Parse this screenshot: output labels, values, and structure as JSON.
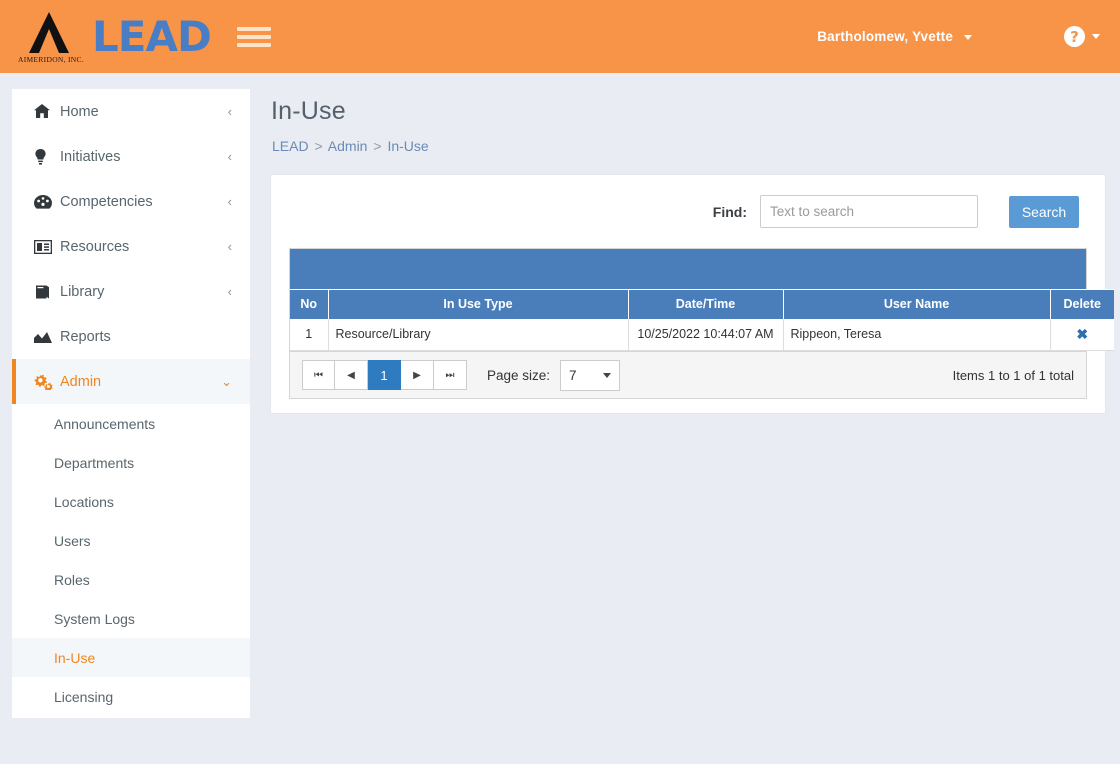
{
  "header": {
    "brand_text": "LEAD",
    "brand_corp": "AIMERIDON, INC.",
    "menu_icon": "hamburger-icon",
    "user_name": "Bartholomew, Yvette",
    "help_glyph": "?",
    "accent_color": "#f79448",
    "logo_color": "#4a7ec4"
  },
  "sidebar": {
    "items": [
      {
        "label": "Home",
        "icon": "home-icon",
        "glyph": "⌂",
        "chevron": "‹",
        "active": false
      },
      {
        "label": "Initiatives",
        "icon": "lightbulb-icon",
        "glyph": "Ὂ1",
        "chevron": "‹",
        "active": false
      },
      {
        "label": "Competencies",
        "icon": "gauge-icon",
        "glyph": "◔",
        "chevron": "‹",
        "active": false
      },
      {
        "label": "Resources",
        "icon": "id-card-icon",
        "glyph": "▤",
        "chevron": "‹",
        "active": false
      },
      {
        "label": "Library",
        "icon": "book-icon",
        "glyph": "◧",
        "chevron": "‹",
        "active": false
      },
      {
        "label": "Reports",
        "icon": "chart-area-icon",
        "glyph": "▲",
        "chevron": "",
        "active": false
      },
      {
        "label": "Admin",
        "icon": "gears-icon",
        "glyph": "⚙",
        "chevron": "⌄",
        "active": true
      }
    ],
    "sub_items": [
      {
        "label": "Announcements",
        "active": false
      },
      {
        "label": "Departments",
        "active": false
      },
      {
        "label": "Locations",
        "active": false
      },
      {
        "label": "Users",
        "active": false
      },
      {
        "label": "Roles",
        "active": false
      },
      {
        "label": "System Logs",
        "active": false
      },
      {
        "label": "In-Use",
        "active": true
      },
      {
        "label": "Licensing",
        "active": false
      }
    ],
    "active_color": "#f0861f"
  },
  "main": {
    "page_title": "In-Use",
    "breadcrumb": {
      "root": "LEAD",
      "level2": "Admin",
      "current": "In-Use",
      "separator": ">"
    },
    "search": {
      "find_label": "Find:",
      "placeholder": "Text to search",
      "value": "",
      "button_label": "Search",
      "button_color": "#5b9bd5"
    },
    "grid": {
      "header_color": "#4a7ebb",
      "columns": [
        "No",
        "In Use Type",
        "Date/Time",
        "User Name",
        "Delete"
      ],
      "rows": [
        {
          "no": "1",
          "in_use_type": "Resource/Library",
          "datetime": "10/25/2022 10:44:07 AM",
          "user_name": "Rippeon, Teresa",
          "delete_glyph": "✖"
        }
      ],
      "footer": {
        "first_glyph": "⏮",
        "prev_glyph": "◀",
        "current_page": "1",
        "next_glyph": "▶",
        "last_glyph": "⏭",
        "page_size_label": "Page size:",
        "page_size_value": "7",
        "items_total": "Items 1 to 1 of 1 total"
      }
    }
  }
}
